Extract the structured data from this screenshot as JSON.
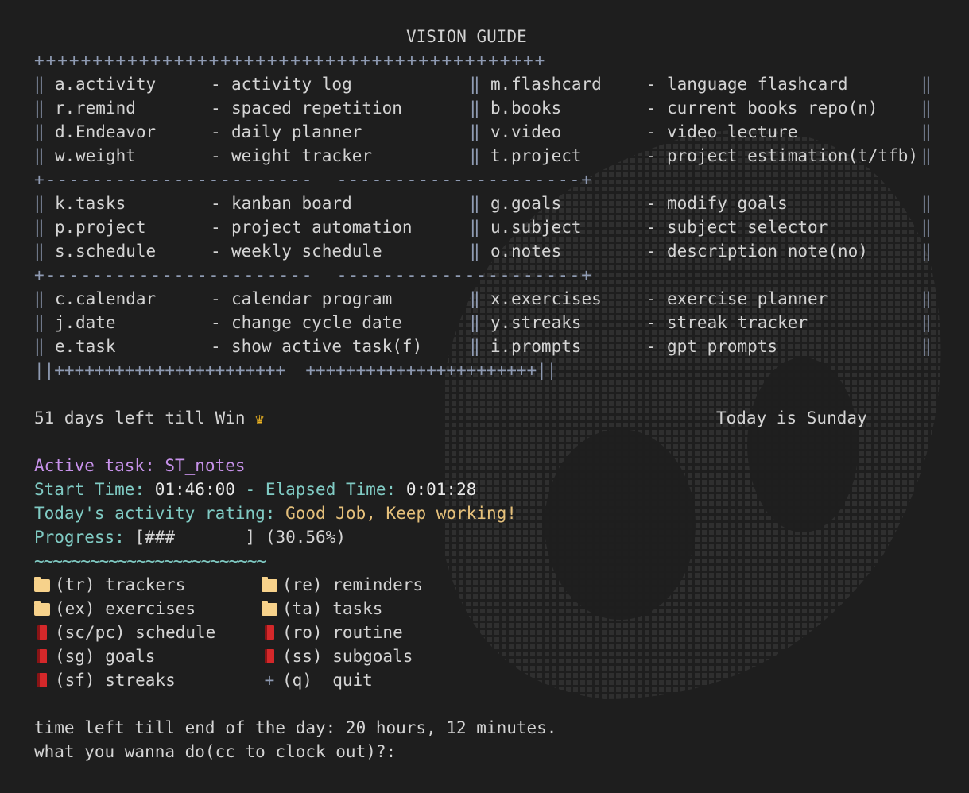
{
  "guide": {
    "title": "VISION GUIDE",
    "border_top": "++++++++++++++++++++++++++++++++++++++++++++",
    "separator": "+-----------------------  ---------------------+",
    "border_bottom": "||+++++++++++++++++++++++  +++++++++++++++++++++++||",
    "pipe": "‖",
    "sections": [
      {
        "rows": [
          {
            "left": {
              "key": "a.",
              "name": "activity",
              "desc": "activity log"
            },
            "right": {
              "key": "m.",
              "name": "flashcard",
              "desc": "language flashcard"
            }
          },
          {
            "left": {
              "key": "r.",
              "name": "remind",
              "desc": "spaced repetition"
            },
            "right": {
              "key": "b.",
              "name": "books",
              "desc": "current books repo(n)"
            }
          },
          {
            "left": {
              "key": "d.",
              "name": "Endeavor",
              "desc": "daily planner"
            },
            "right": {
              "key": "v.",
              "name": "video",
              "desc": "video lecture"
            }
          },
          {
            "left": {
              "key": "w.",
              "name": "weight",
              "desc": "weight tracker"
            },
            "right": {
              "key": "t.",
              "name": "project",
              "desc": "project estimation(t/tfb)"
            }
          }
        ]
      },
      {
        "rows": [
          {
            "left": {
              "key": "k.",
              "name": "tasks",
              "desc": "kanban board"
            },
            "right": {
              "key": "g.",
              "name": "goals",
              "desc": "modify goals"
            }
          },
          {
            "left": {
              "key": "p.",
              "name": "project",
              "desc": "project automation"
            },
            "right": {
              "key": "u.",
              "name": "subject",
              "desc": "subject selector"
            }
          },
          {
            "left": {
              "key": "s.",
              "name": "schedule",
              "desc": "weekly schedule"
            },
            "right": {
              "key": "o.",
              "name": "notes",
              "desc": "description note(no)"
            }
          }
        ]
      },
      {
        "rows": [
          {
            "left": {
              "key": "c.",
              "name": "calendar",
              "desc": "calendar program"
            },
            "right": {
              "key": "x.",
              "name": "exercises",
              "desc": "exercise planner"
            }
          },
          {
            "left": {
              "key": "j.",
              "name": "date",
              "desc": "change cycle date"
            },
            "right": {
              "key": "y.",
              "name": "streaks",
              "desc": "streak tracker"
            }
          },
          {
            "left": {
              "key": "e.",
              "name": "task",
              "desc": "show active task(f)"
            },
            "right": {
              "key": "i.",
              "name": "prompts",
              "desc": "gpt prompts"
            }
          }
        ]
      }
    ]
  },
  "status": {
    "days_left": "51 days left till Win",
    "today": "Today is Sunday",
    "active_task_label": "Active task: ST_notes",
    "start_time_label": "Start Time:",
    "start_time": "01:46:00",
    "elapsed_sep": "- Elapsed Time:",
    "elapsed_time": "0:01:28",
    "rating_label": "Today's activity rating:",
    "rating": "Good Job, Keep working!",
    "progress_label": "Progress:",
    "progress_bar": "[###       ]",
    "progress_pct": "(30.56%)",
    "progress_value": 30.56,
    "divider": "~~~~~~~~~~~~~~~~~~~~~~~~~"
  },
  "menu": [
    [
      {
        "icon": "folder-icon",
        "label": "(tr) trackers"
      },
      {
        "icon": "folder-icon",
        "label": "(re) reminders"
      }
    ],
    [
      {
        "icon": "folder-icon",
        "label": "(ex) exercises"
      },
      {
        "icon": "folder-icon",
        "label": "(ta) tasks"
      }
    ],
    [
      {
        "icon": "book-icon",
        "label": "(sc/pc) schedule"
      },
      {
        "icon": "book-icon",
        "label": "(ro) routine"
      }
    ],
    [
      {
        "icon": "book-icon",
        "label": "(sg) goals"
      },
      {
        "icon": "book-icon",
        "label": "(ss) subgoals"
      }
    ],
    [
      {
        "icon": "book-icon",
        "label": "(sf) streaks"
      },
      {
        "icon": "plus-icon",
        "label": "(q)  quit"
      }
    ]
  ],
  "footer": {
    "time_left": "time left till end of the day: 20 hours, 12 minutes.",
    "prompt": "what you wanna do(cc to clock out)?:"
  },
  "colors": {
    "background": "#1e1e1e",
    "border": "#8f9bb3",
    "active_task": "#c792ea",
    "teal": "#80cbc4",
    "rating": "#e5c07b"
  }
}
